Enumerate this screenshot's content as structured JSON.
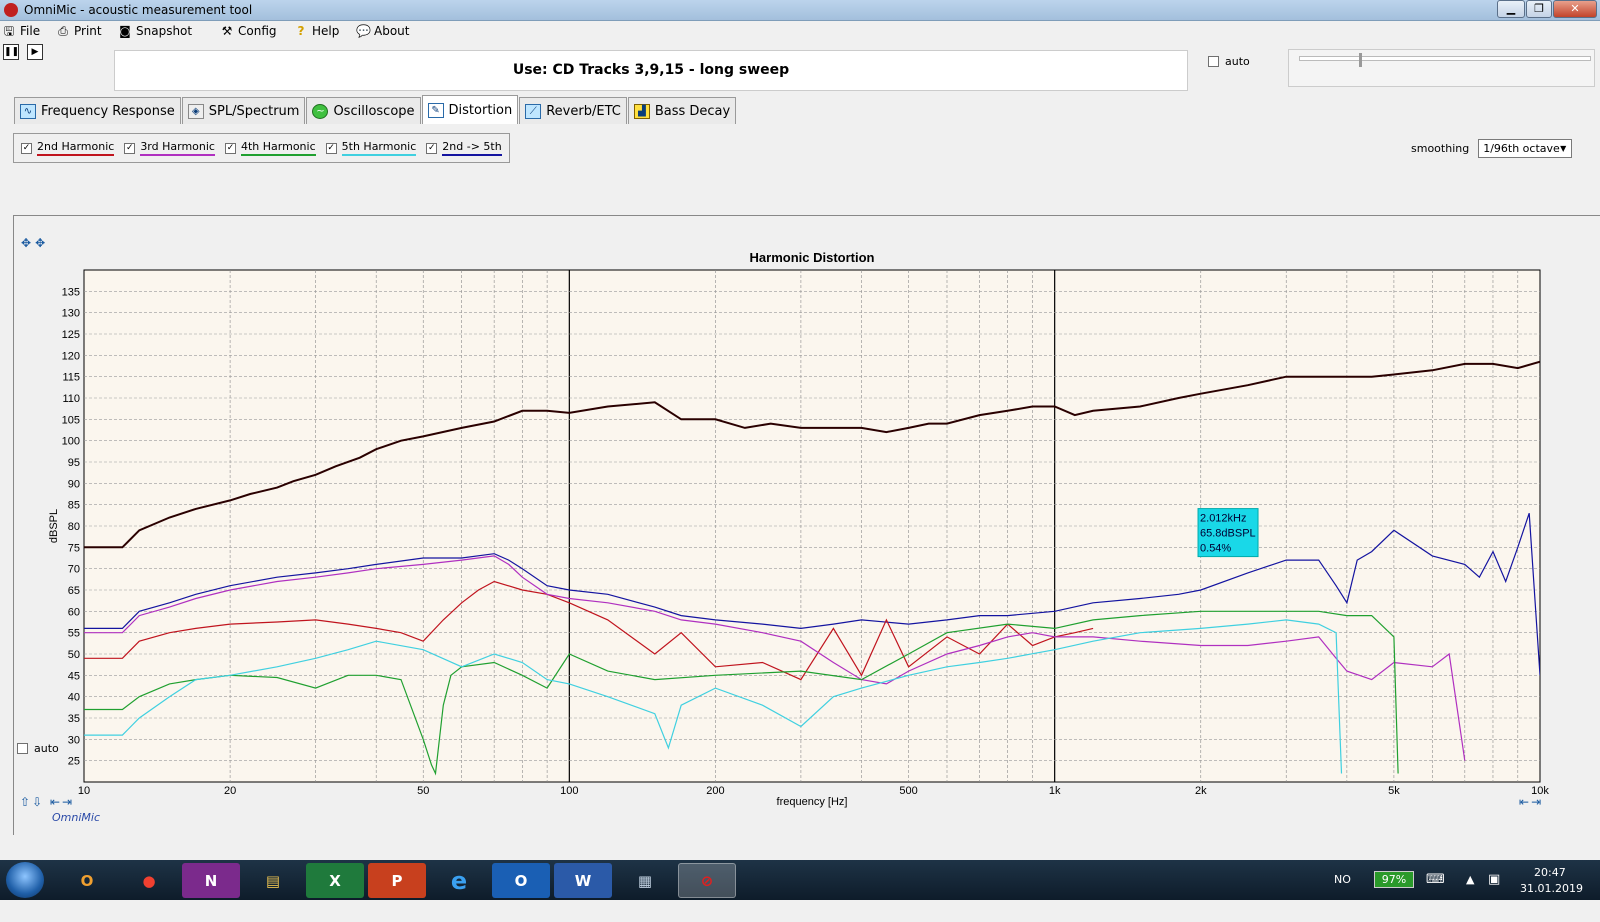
{
  "window": {
    "title": "OmniMic - acoustic measurement tool",
    "min": "▁",
    "max": "❐",
    "close": "✕"
  },
  "menu": [
    {
      "label": "File",
      "icon": "floppy-icon"
    },
    {
      "label": "Print",
      "icon": "printer-icon"
    },
    {
      "label": "Snapshot",
      "icon": "camera-icon"
    },
    {
      "label": "Config",
      "icon": "tools-icon"
    },
    {
      "label": "Help",
      "icon": "question-icon"
    },
    {
      "label": "About",
      "icon": "speech-bubble-icon"
    }
  ],
  "banner": "Use: CD Tracks 3,9,15 - long sweep",
  "top_auto_label": "auto",
  "tabs": [
    {
      "label": "Frequency Response",
      "active": false
    },
    {
      "label": "SPL/Spectrum",
      "active": false
    },
    {
      "label": "Oscilloscope",
      "active": false
    },
    {
      "label": "Distortion",
      "active": true
    },
    {
      "label": "Reverb/ETC",
      "active": false
    },
    {
      "label": "Bass Decay",
      "active": false
    }
  ],
  "harmonics": [
    {
      "label": "2nd Harmonic",
      "checked": true,
      "color": "#c0141e"
    },
    {
      "label": "3rd Harmonic",
      "checked": true,
      "color": "#b030c0"
    },
    {
      "label": "4th Harmonic",
      "checked": true,
      "color": "#20a030"
    },
    {
      "label": "5th Harmonic",
      "checked": true,
      "color": "#40d0e0"
    },
    {
      "label": "2nd -> 5th",
      "checked": true,
      "color": "#1414a0"
    }
  ],
  "smoothing": {
    "label": "smoothing",
    "value": "1/96th octave"
  },
  "graph_auto_label": "auto",
  "logo": "OmniMic",
  "chart_data": {
    "type": "line",
    "title": "Harmonic Distortion",
    "xlabel": "frequency [Hz]",
    "ylabel": "dBSPL",
    "xscale": "log",
    "xlim": [
      10,
      10000
    ],
    "ylim": [
      20,
      140
    ],
    "x_ticks": [
      10,
      20,
      50,
      100,
      200,
      500,
      1000,
      2000,
      5000,
      10000
    ],
    "x_tick_labels": [
      "10",
      "20",
      "50",
      "100",
      "200",
      "500",
      "1k",
      "2k",
      "5k",
      "10k"
    ],
    "y_ticks": [
      25,
      30,
      35,
      40,
      45,
      50,
      55,
      60,
      65,
      70,
      75,
      80,
      85,
      90,
      95,
      100,
      105,
      110,
      115,
      120,
      125,
      130,
      135
    ],
    "grid": true,
    "tooltip": {
      "x": 2012,
      "y": 65.8,
      "lines": [
        "2.012kHz",
        "65.8dBSPL",
        "0.54%"
      ]
    },
    "series": [
      {
        "color": "#2a0000",
        "x": [
          10,
          12,
          13,
          15,
          17,
          20,
          22,
          25,
          27,
          30,
          33,
          37,
          40,
          45,
          50,
          60,
          70,
          80,
          90,
          100,
          120,
          150,
          170,
          200,
          230,
          260,
          300,
          350,
          400,
          450,
          500,
          550,
          600,
          700,
          800,
          900,
          1000,
          1100,
          1200,
          1500,
          1800,
          2000,
          2500,
          3000,
          3500,
          4000,
          4500,
          5000,
          6000,
          7000,
          8000,
          9000,
          10000
        ],
        "y": [
          75,
          75,
          79,
          82,
          84,
          86,
          87.5,
          89,
          90.5,
          92,
          94,
          96,
          98,
          100,
          101,
          103,
          104.5,
          107,
          107,
          106.5,
          108,
          109,
          105,
          105,
          103,
          104,
          103,
          103,
          103,
          102,
          103,
          104,
          104,
          106,
          107,
          108,
          108,
          106,
          107,
          108,
          110,
          111,
          113,
          115,
          115,
          115,
          115,
          115.5,
          116.5,
          118,
          118,
          117,
          118.5
        ]
      },
      {
        "color": "#1414a0",
        "x": [
          10,
          12,
          13,
          15,
          17,
          20,
          25,
          30,
          35,
          40,
          50,
          60,
          70,
          75,
          80,
          90,
          100,
          120,
          150,
          170,
          200,
          250,
          300,
          350,
          400,
          500,
          600,
          700,
          800,
          1000,
          1200,
          1500,
          1800,
          2000,
          2500,
          3000,
          3500,
          3800,
          4000,
          4200,
          4500,
          5000,
          6000,
          7000,
          7500,
          8000,
          8500,
          9000,
          9500,
          10000
        ],
        "y": [
          56,
          56,
          60,
          62,
          64,
          66,
          68,
          69,
          70,
          71,
          72.5,
          72.5,
          73.5,
          72,
          70,
          66,
          65,
          64,
          61,
          59,
          58,
          57,
          56,
          57,
          58,
          57,
          58,
          59,
          59,
          60,
          62,
          63,
          64,
          65,
          69,
          72,
          72,
          66,
          62,
          72,
          74,
          79,
          73,
          71,
          68,
          74,
          67,
          75,
          83,
          45
        ]
      },
      {
        "color": "#c0141e",
        "x": [
          10,
          12,
          13,
          15,
          17,
          20,
          25,
          30,
          35,
          40,
          45,
          50,
          55,
          60,
          65,
          70,
          80,
          90,
          100,
          120,
          150,
          170,
          200,
          250,
          300,
          350,
          400,
          450,
          500,
          600,
          700,
          800,
          900,
          1000,
          1100,
          1200
        ],
        "y": [
          49,
          49,
          53,
          55,
          56,
          57,
          57.5,
          58,
          57,
          56,
          55,
          53,
          58,
          62,
          65,
          67,
          65,
          64,
          62,
          58,
          50,
          55,
          47,
          48,
          44,
          56,
          45,
          58,
          47,
          54,
          50,
          57,
          52,
          54,
          55,
          56
        ]
      },
      {
        "color": "#b030c0",
        "x": [
          10,
          12,
          13,
          15,
          17,
          20,
          25,
          30,
          35,
          40,
          50,
          60,
          70,
          75,
          80,
          90,
          100,
          120,
          150,
          170,
          200,
          250,
          300,
          350,
          400,
          450,
          500,
          600,
          700,
          800,
          900,
          1000,
          1200,
          1500,
          2000,
          2500,
          3000,
          3500,
          3800,
          4000,
          4500,
          5000,
          6000,
          6500,
          7000
        ],
        "y": [
          55,
          55,
          59,
          61,
          63,
          65,
          67,
          68,
          69,
          70,
          71,
          72,
          73,
          71,
          68,
          64,
          63,
          62,
          60,
          58,
          57,
          55,
          53,
          48,
          44,
          43,
          46,
          50,
          52,
          54,
          55,
          54,
          54,
          53,
          52,
          52,
          53,
          54,
          49,
          46,
          44,
          48,
          47,
          50,
          25
        ]
      },
      {
        "color": "#20a030",
        "x": [
          10,
          12,
          13,
          15,
          17,
          20,
          25,
          30,
          35,
          40,
          45,
          50,
          52,
          53,
          55,
          57,
          60,
          70,
          80,
          90,
          100,
          120,
          150,
          200,
          300,
          400,
          500,
          600,
          800,
          1000,
          1200,
          1500,
          2000,
          2500,
          3000,
          3500,
          4000,
          4500,
          5000,
          5100
        ],
        "y": [
          37,
          37,
          40,
          43,
          44,
          45,
          44.5,
          42,
          45,
          45,
          44,
          30,
          24,
          22,
          38,
          45,
          47,
          48,
          45,
          42,
          50,
          46,
          44,
          45,
          46,
          44,
          50,
          55,
          57,
          56,
          58,
          59,
          60,
          60,
          60,
          60,
          59,
          59,
          54,
          22
        ]
      },
      {
        "color": "#40d0e0",
        "x": [
          10,
          11,
          12,
          13,
          15,
          17,
          20,
          25,
          30,
          35,
          40,
          50,
          60,
          70,
          80,
          90,
          100,
          120,
          150,
          160,
          170,
          200,
          250,
          300,
          350,
          400,
          500,
          600,
          700,
          800,
          1000,
          1200,
          1500,
          2000,
          2500,
          3000,
          3500,
          3800,
          3900
        ],
        "y": [
          31,
          31,
          31,
          35,
          40,
          44,
          45,
          47,
          49,
          51,
          53,
          51,
          47,
          50,
          48,
          44,
          43,
          40,
          36,
          28,
          38,
          42,
          38,
          33,
          40,
          42,
          45,
          47,
          48,
          49,
          51,
          53,
          55,
          56,
          57,
          58,
          57,
          55,
          22
        ]
      }
    ]
  },
  "taskbar": {
    "apps": [
      "O",
      "●",
      "N",
      "▤",
      "X",
      "P",
      "e",
      "O",
      "W",
      "▦",
      "⊘"
    ],
    "lang": "NO",
    "battery": "97%",
    "time": "20:47",
    "date": "31.01.2019"
  }
}
